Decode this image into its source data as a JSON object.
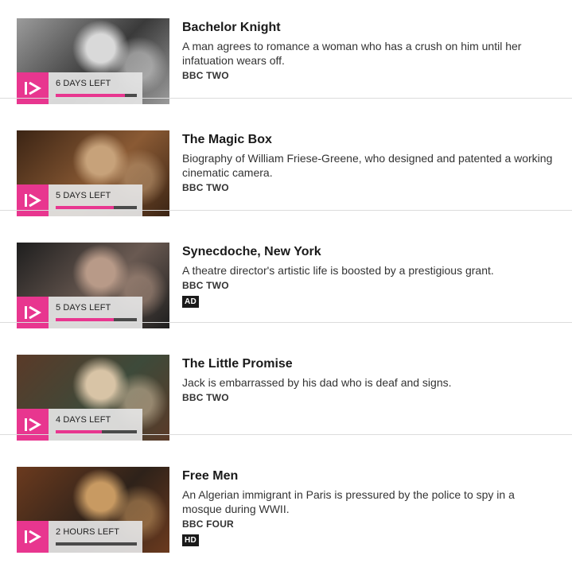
{
  "programmes": [
    {
      "title": "Bachelor Knight",
      "description": "A man agrees to romance a woman who has a crush on him until her infatuation wears off.",
      "channel": "BBC TWO",
      "availability": "6 DAYS LEFT",
      "progress_filled": 6,
      "progress_total": 7,
      "tag": "",
      "thumb_colors": [
        "#9b9b9b",
        "#3a3a3a",
        "#d9d9d9"
      ]
    },
    {
      "title": "The Magic Box",
      "description": "Biography of William Friese-Greene, who designed and patented a working cinematic camera.",
      "channel": "BBC TWO",
      "availability": "5 DAYS LEFT",
      "progress_filled": 5,
      "progress_total": 7,
      "tag": "",
      "thumb_colors": [
        "#3b2414",
        "#8a5a34",
        "#c7a27a"
      ]
    },
    {
      "title": "Synecdoche, New York",
      "description": "A theatre director's artistic life is boosted by a prestigious grant.",
      "channel": "BBC TWO",
      "availability": "5 DAYS LEFT",
      "progress_filled": 5,
      "progress_total": 7,
      "tag": "AD",
      "thumb_colors": [
        "#1e1e1e",
        "#6a5a52",
        "#b89a88"
      ]
    },
    {
      "title": "The Little Promise",
      "description": "Jack is embarrassed by his dad who is deaf and signs.",
      "channel": "BBC TWO",
      "availability": "4 DAYS LEFT",
      "progress_filled": 4,
      "progress_total": 7,
      "tag": "",
      "thumb_colors": [
        "#5a3a28",
        "#3d4a3a",
        "#d8c4a6"
      ]
    },
    {
      "title": "Free Men",
      "description": "An Algerian immigrant in Paris is pressured by the police to spy in a mosque during WWII.",
      "channel": "BBC FOUR",
      "availability": "2 HOURS LEFT",
      "progress_filled": 0,
      "progress_total": 7,
      "tag": "HD",
      "thumb_colors": [
        "#6b3a1e",
        "#2e221a",
        "#c89a62"
      ]
    }
  ],
  "colors": {
    "accent": "#e8368f",
    "bar_empty": "#4a4a4a"
  },
  "icons": {
    "badge": "iplayer-play-icon"
  }
}
